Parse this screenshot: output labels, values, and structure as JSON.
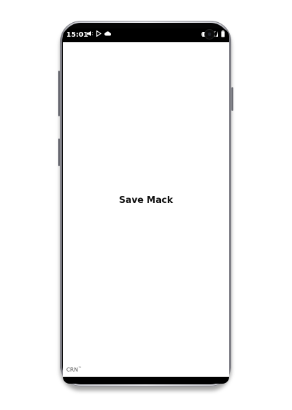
{
  "status_bar": {
    "time": "15:01",
    "left_icons": [
      "megaphone-icon",
      "play-store-icon",
      "cloud-icon"
    ],
    "right_icons": [
      "vibrate-icon",
      "signal-icon",
      "battery-icon"
    ]
  },
  "app": {
    "title": "Save Mack",
    "brand": "CRN",
    "brand_mark": "™"
  }
}
